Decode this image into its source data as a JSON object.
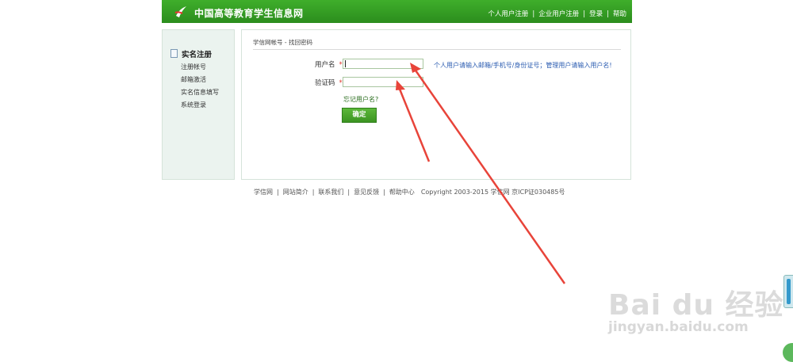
{
  "header": {
    "title": "中国高等教育学生信息网",
    "nav": [
      "个人用户注册",
      "企业用户注册",
      "登录",
      "帮助"
    ],
    "separator": "|"
  },
  "sidebar": {
    "heading": "实名注册",
    "items": [
      "注册帐号",
      "邮箱激活",
      "实名信息填写",
      "系统登录"
    ]
  },
  "main": {
    "breadcrumb": "学信网帐号 - 找回密码",
    "username_label": "用户名",
    "captcha_label": "验证码",
    "required_mark": "*",
    "username_value": "",
    "captcha_value": "",
    "hint": "个人用户请输入邮箱/手机号/身份证号；管理用户请输入用户名!",
    "forgot_link": "忘记用户名?",
    "submit_label": "确定"
  },
  "footer": {
    "links": [
      "学信网",
      "网站简介",
      "联系我们",
      "意见反馈",
      "帮助中心"
    ],
    "copyright": "Copyright 2003-2015 学信网 京ICP证030485号"
  },
  "watermark": {
    "logo_text": "Bai du 经验",
    "url": "jingyan.baidu.com"
  },
  "colors": {
    "header_green": "#2f9a22",
    "link_blue": "#2a5bb0",
    "arrow_red": "#e8443a"
  }
}
